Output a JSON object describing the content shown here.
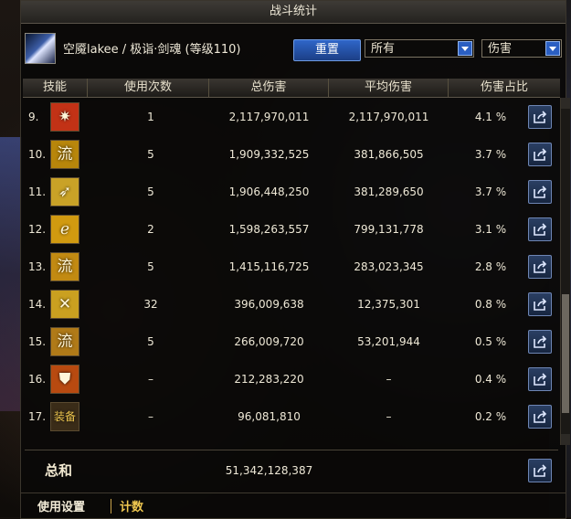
{
  "window": {
    "title": "战斗统计"
  },
  "header": {
    "character": "空魇lakee / 极诣·剑魂 (等级110)",
    "reset_label": "重置",
    "filter_target": "所有",
    "filter_metric": "伤害"
  },
  "columns": [
    "技能",
    "使用次数",
    "总伤害",
    "平均伤害",
    "伤害占比"
  ],
  "rows": [
    {
      "index": "9.",
      "icon": "skill-9-icon",
      "glyph": "✷",
      "icon_color": "#c23216",
      "uses": "1",
      "total": "2,117,970,011",
      "avg": "2,117,970,011",
      "pct": "4.1 %"
    },
    {
      "index": "10.",
      "icon": "skill-10-icon",
      "glyph": "流",
      "icon_color": "#b8860b",
      "uses": "5",
      "total": "1,909,332,525",
      "avg": "381,866,505",
      "pct": "3.7 %"
    },
    {
      "index": "11.",
      "icon": "skill-11-icon",
      "glyph": "➶",
      "icon_color": "#c9a227",
      "uses": "5",
      "total": "1,906,448,250",
      "avg": "381,289,650",
      "pct": "3.7 %"
    },
    {
      "index": "12.",
      "icon": "skill-12-icon",
      "glyph": "ℯ",
      "icon_color": "#d19a10",
      "uses": "2",
      "total": "1,598,263,557",
      "avg": "799,131,778",
      "pct": "3.1 %"
    },
    {
      "index": "13.",
      "icon": "skill-13-icon",
      "glyph": "流",
      "icon_color": "#c28a12",
      "uses": "5",
      "total": "1,415,116,725",
      "avg": "283,023,345",
      "pct": "2.8 %"
    },
    {
      "index": "14.",
      "icon": "skill-14-icon",
      "glyph": "✕",
      "icon_color": "#caa020",
      "uses": "32",
      "total": "396,009,638",
      "avg": "12,375,301",
      "pct": "0.8 %"
    },
    {
      "index": "15.",
      "icon": "skill-15-icon",
      "glyph": "流",
      "icon_color": "#b07a18",
      "uses": "5",
      "total": "266,009,720",
      "avg": "53,201,944",
      "pct": "0.5 %"
    },
    {
      "index": "16.",
      "icon": "skill-16-icon",
      "glyph": "⛊",
      "icon_color": "#b84a10",
      "uses": "–",
      "total": "212,283,220",
      "avg": "–",
      "pct": "0.4 %"
    },
    {
      "index": "17.",
      "icon": "skill-17-icon",
      "glyph": "装备",
      "icon_color": "#3a2c18",
      "uses": "–",
      "total": "96,081,810",
      "avg": "–",
      "pct": "0.2 %"
    }
  ],
  "summary": {
    "label": "总和",
    "total": "51,342,128,387"
  },
  "footer": {
    "settings_label": "使用设置",
    "count_label": "计数"
  },
  "colors": {
    "accent_blue": "#2b5fc2",
    "highlight_gold": "#f0c850"
  }
}
